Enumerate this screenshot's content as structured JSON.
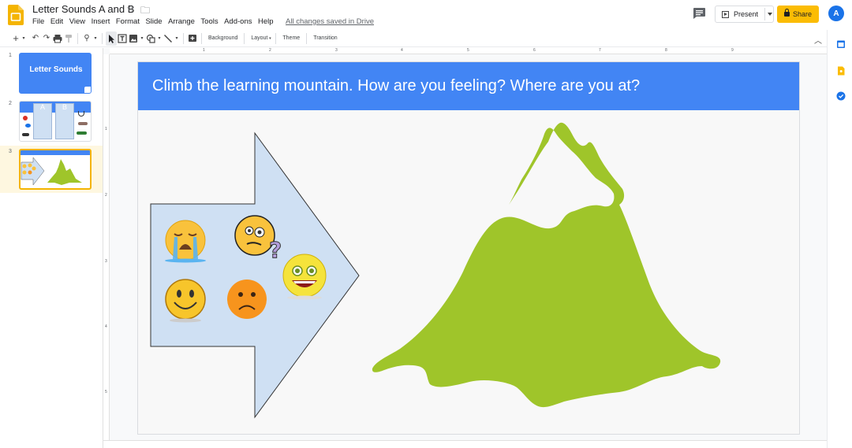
{
  "app": {
    "doc_title": "Letter Sounds A and B",
    "save_status": "All changes saved in Drive",
    "avatar_letter": "A",
    "accent_color": "#fbbc04",
    "present_label": "Present",
    "share_label": "Share"
  },
  "menu": [
    "File",
    "Edit",
    "View",
    "Insert",
    "Format",
    "Slide",
    "Arrange",
    "Tools",
    "Add-ons",
    "Help"
  ],
  "toolbar": {
    "background_label": "Background",
    "layout_label": "Layout",
    "theme_label": "Theme",
    "transition_label": "Transition"
  },
  "ruler": {
    "h_marks": [
      "1",
      "2",
      "3",
      "4",
      "5",
      "6",
      "7",
      "8",
      "9"
    ],
    "v_marks": [
      "1",
      "2",
      "3",
      "4",
      "5"
    ]
  },
  "filmstrip": {
    "slides": [
      {
        "number": "1",
        "title": "Letter Sounds"
      },
      {
        "number": "2",
        "letters": [
          "A",
          "B"
        ]
      },
      {
        "number": "3",
        "selected": true
      }
    ]
  },
  "slide": {
    "title": "Climb the learning mountain. How are you feeling? Where are you at?",
    "title_bar_color": "#4285f4",
    "arrow_color": "#cfe0f3",
    "mountain_color": "#9fc52a",
    "emojis": [
      "crying-face",
      "confused-face",
      "happy-face",
      "sad-face",
      "excited-face"
    ]
  }
}
